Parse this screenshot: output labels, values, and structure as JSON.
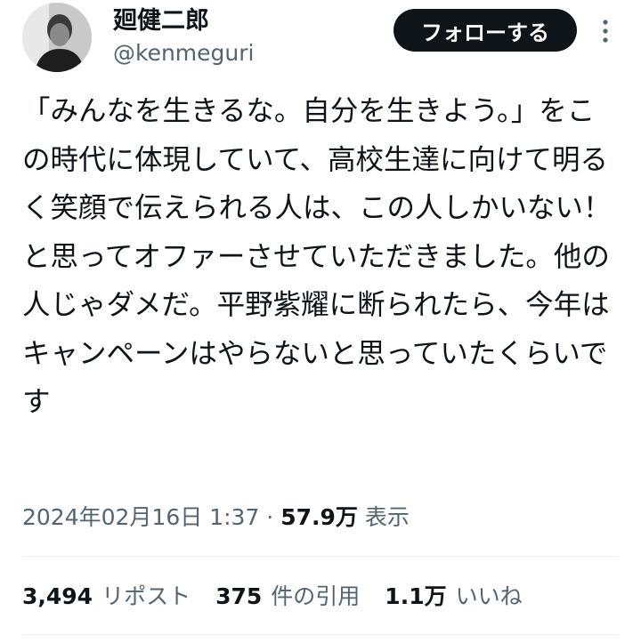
{
  "author": {
    "display_name": "廻健二郎",
    "handle": "@kenmeguri",
    "avatar_icon": "avatar-photo-icon"
  },
  "actions": {
    "follow_label": "フォローする",
    "more_icon": "more-vertical-icon"
  },
  "tweet": {
    "text": "「みんなを生きるな。自分を生きよう。」をこの時代に体現していて、高校生達に向けて明るく笑顔で伝えられる人は、この人しかいない！と思ってオファーさせていただきました。他の人じゃダメだ。平野紫耀に断られたら、今年はキャンペーンはやらないと思っていたくらいです"
  },
  "meta": {
    "date": "2024年02月16日",
    "time": "1:37",
    "separator": "·",
    "views_count": "57.9万",
    "views_label": "表示"
  },
  "stats": {
    "reposts_count": "3,494",
    "reposts_label": "リポスト",
    "quotes_count": "375",
    "quotes_label": "件の引用",
    "likes_count": "1.1万",
    "likes_label": "いいね"
  },
  "colors": {
    "text_primary": "#0f1419",
    "text_secondary": "#536471",
    "divider": "#eff3f4",
    "button_bg": "#0f1419"
  }
}
